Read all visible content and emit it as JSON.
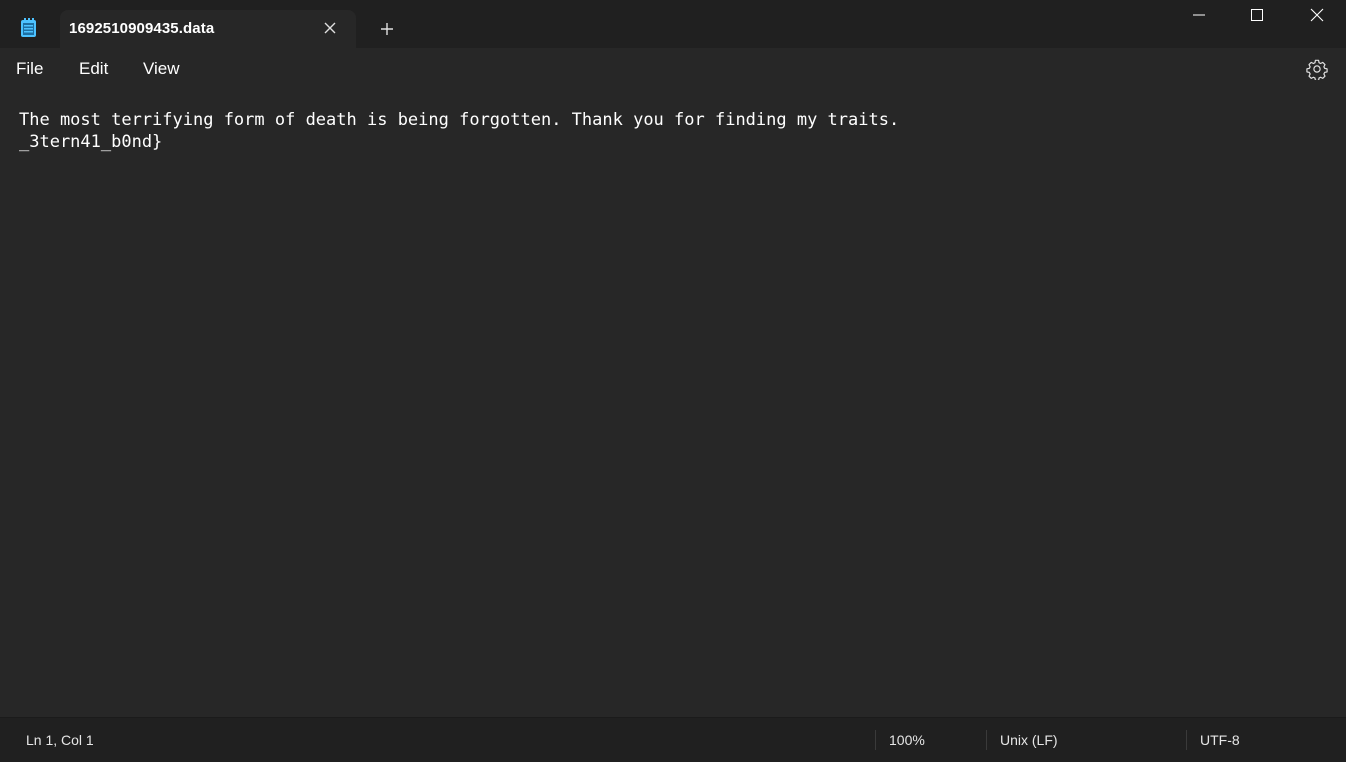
{
  "titlebar": {
    "app_icon": "notepad-icon",
    "tab_title": "1692510909435.data",
    "tab_close_icon": "close-icon",
    "new_tab_icon": "plus-icon",
    "window_controls": [
      "minimize-icon",
      "maximize-icon",
      "close-icon"
    ]
  },
  "menubar": {
    "items": [
      "File",
      "Edit",
      "View"
    ],
    "settings_icon": "gear-icon"
  },
  "editor": {
    "lines": [
      "The most terrifying form of death is being forgotten. Thank you for finding my traits.",
      "_3tern41_b0nd}"
    ]
  },
  "statusbar": {
    "position": "Ln 1, Col 1",
    "zoom": "100%",
    "line_ending": "Unix (LF)",
    "encoding": "UTF-8"
  },
  "colors": {
    "titlebar_bg": "#202020",
    "tab_bg": "#272727",
    "editor_bg": "#272727",
    "text": "#ffffff",
    "app_icon_accent": "#4cc2ff"
  }
}
